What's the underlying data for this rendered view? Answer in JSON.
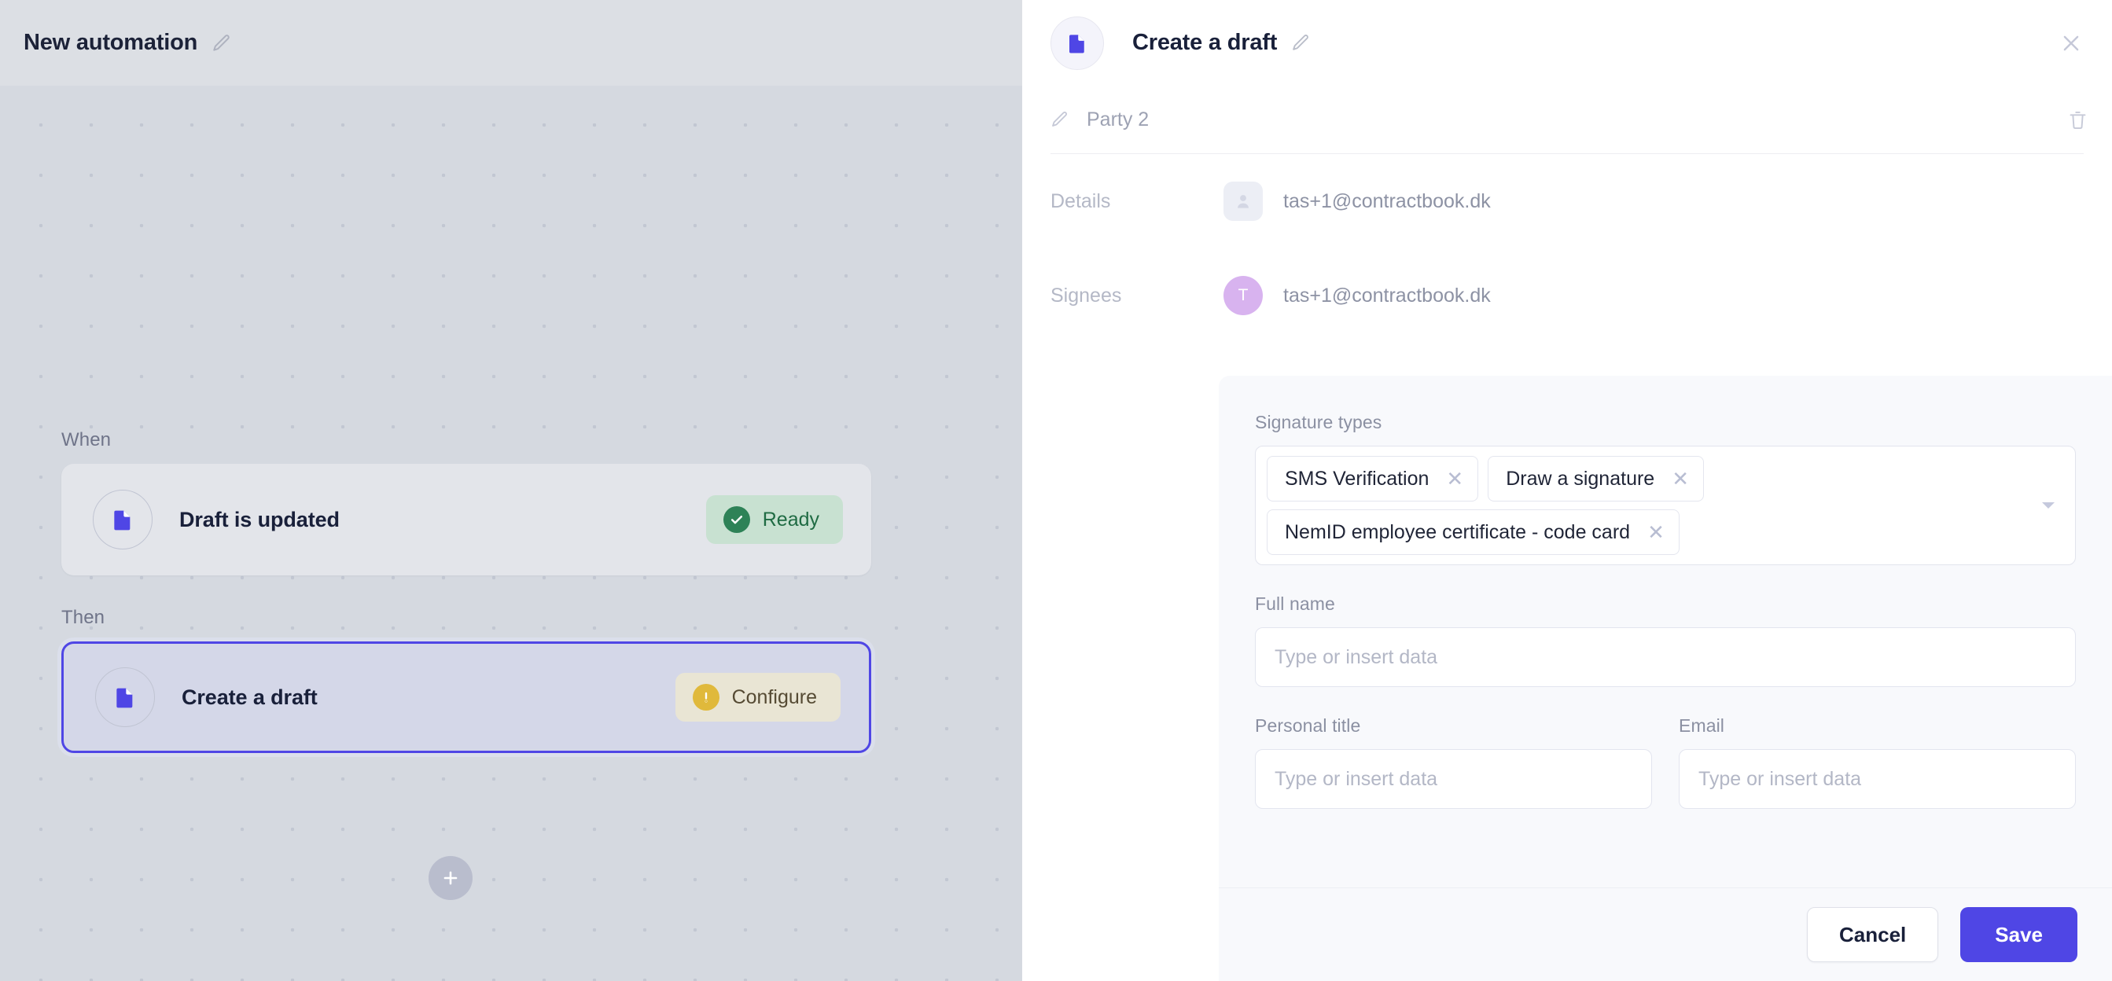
{
  "left": {
    "header": {
      "title": "New automation",
      "edit_icon": "pencil-icon"
    },
    "when_label": "When",
    "then_label": "Then",
    "trigger_card": {
      "icon": "document-icon",
      "title": "Draft is updated",
      "status_label": "Ready",
      "status_icon": "check-circle-icon",
      "status_bg": "#c8e1d1",
      "status_color": "#1f6b43"
    },
    "action_card": {
      "icon": "document-icon",
      "title": "Create a draft",
      "status_label": "Configure",
      "status_icon": "exclamation-circle-icon",
      "status_bg": "#e9e5d4",
      "status_color": "#554a33",
      "selected_border": "#4f46e5"
    },
    "add_step_button": {
      "icon": "plus-icon",
      "label": "+"
    }
  },
  "right": {
    "header": {
      "icon": "document-icon",
      "title": "Create a draft",
      "edit_icon": "pencil-icon",
      "close_icon": "close-icon"
    },
    "party": {
      "edit_icon": "pencil-icon",
      "name": "Party 2",
      "delete_icon": "trash-icon"
    },
    "details": {
      "label": "Details",
      "avatar_icon": "person-icon",
      "value": "tas+1@contractbook.dk"
    },
    "signees": {
      "label": "Signees",
      "avatar_initial": "T",
      "avatar_color": "#d8b3ef",
      "value": "tas+1@contractbook.dk"
    },
    "signature_types": {
      "label": "Signature types",
      "caret_icon": "chevron-down-icon",
      "chips": [
        {
          "label": "SMS Verification",
          "remove_icon": "close-icon"
        },
        {
          "label": "Draw a signature",
          "remove_icon": "close-icon"
        },
        {
          "label": "NemID employee certificate - code card",
          "remove_icon": "close-icon"
        }
      ]
    },
    "full_name": {
      "label": "Full name",
      "placeholder": "Type or insert data",
      "value": ""
    },
    "personal_title": {
      "label": "Personal title",
      "placeholder": "Type or insert data",
      "value": ""
    },
    "email": {
      "label": "Email",
      "placeholder": "Type or insert data",
      "value": ""
    },
    "footer": {
      "cancel_label": "Cancel",
      "save_label": "Save",
      "save_color": "#4f46e5"
    }
  }
}
